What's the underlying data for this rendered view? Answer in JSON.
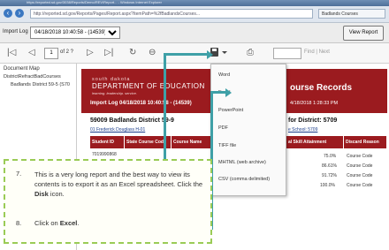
{
  "browser": {
    "title": "https://reported.sd.gov/3038/Reports/Demo/REV/Report... - Windows Internet Explorer",
    "url": "http://reported.sd.gov/Reports/Pages/Report.aspx?ItemPath=%2fBadlandsCourses...",
    "tab_label": "Badlands Courses"
  },
  "selector": {
    "label": "Import Log",
    "selected": "04/18/2018 10:40:58 - (14539)",
    "view_report_label": "View Report"
  },
  "toolbar": {
    "first": "|◁",
    "prev": "◁",
    "page_value": "1",
    "page_of": "of 2 ?",
    "next": "▷",
    "last": "▷|",
    "refresh": "↻",
    "back": "⊖",
    "print": "⎙",
    "find_next": "Find | Next"
  },
  "docmap": {
    "heading": "Document Map",
    "item1": "DistrictRefractBadCourses",
    "item2": "Badlands District 59-5 (S70"
  },
  "report": {
    "logo_line1": "south dakota",
    "logo_line2": "DEPARTMENT OF EDUCATION",
    "logo_line3": "learning. leadership. service.",
    "banner_title": "Import Log 04/18/2018 10:40:58 - (14539)",
    "title": "ourse Records",
    "date": "4/18/2018 1:28:33 PM",
    "school": "59009 Badlands District 59-9",
    "student_link": "01 Frederick Douglass H-01",
    "side_heading": "for District: 5709",
    "side_link": "e School: 5709",
    "headers": [
      "Student ID",
      "State Course Code",
      "Course Name",
      "al Skill Attainment",
      "Discard Reason"
    ],
    "rows": [
      {
        "pct": "75.0%",
        "reason": "Course Code"
      },
      {
        "pct": "86.61%",
        "reason": "Course Code"
      },
      {
        "pct": "91.72%",
        "reason": "Course Code"
      },
      {
        "pct": "100.0%",
        "reason": "Course Code"
      }
    ],
    "row1_id": "7019990868"
  },
  "export_menu": {
    "items": [
      "Word",
      "Excel",
      "PowerPoint",
      "PDF",
      "TIFF file",
      "MHTML (web archive)",
      "CSV (comma delimited)"
    ]
  },
  "callout": {
    "step7_num": "7.",
    "step7_text_a": "This is a very long report and the best way to view its contents is to export it as an Excel spreadsheet. Click the ",
    "step7_bold": "Disk",
    "step7_text_b": " icon.",
    "step8_num": "8.",
    "step8_text_a": "Click on ",
    "step8_bold": "Excel",
    "step8_text_b": "."
  },
  "colors": {
    "banner": "#9b1b1f",
    "arrow": "#3fa0a7",
    "callout_border": "#9acb56"
  }
}
